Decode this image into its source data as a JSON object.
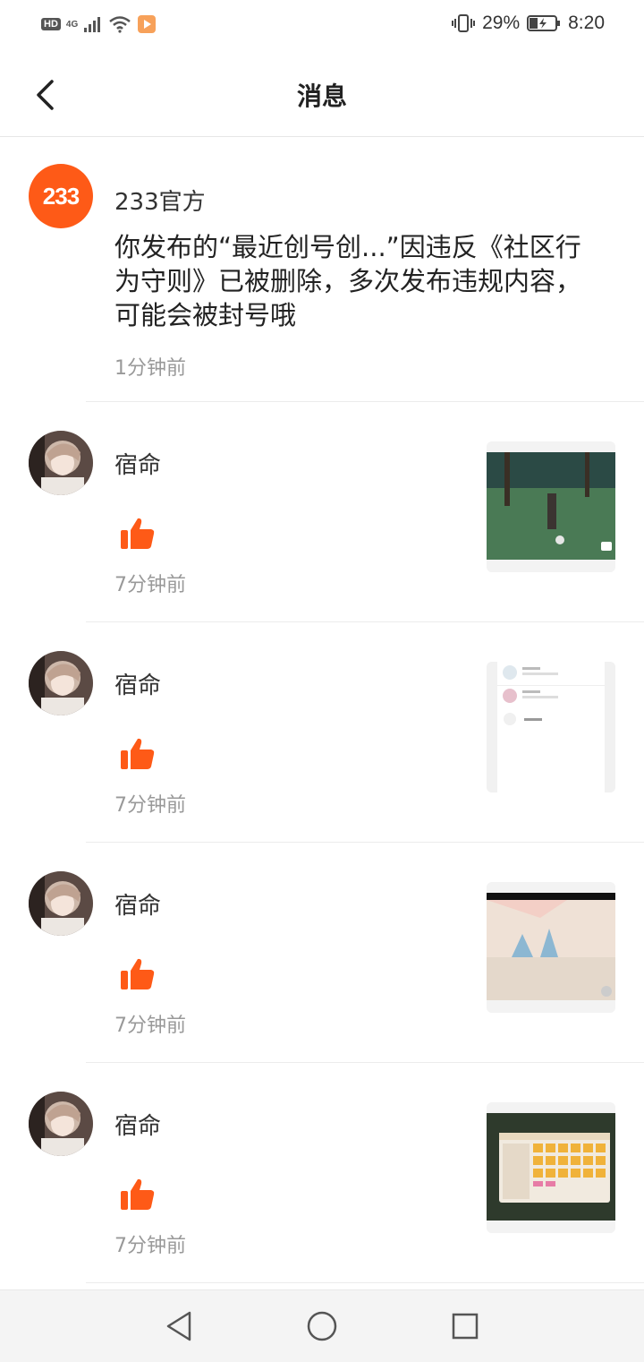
{
  "status_bar": {
    "hd": "HD",
    "network": "4G",
    "battery_percent": "29%",
    "time": "8:20"
  },
  "header": {
    "title": "消息"
  },
  "official_message": {
    "avatar_text": "233",
    "sender": "233官方",
    "content": "你发布的“最近创号创...”因违反《社区行为守则》已被删除，多次发布违规内容，可能会被封号哦",
    "time": "1分钟前"
  },
  "like_messages": [
    {
      "sender": "宿命",
      "time": "7分钟前",
      "preview": "game-scene-forest"
    },
    {
      "sender": "宿命",
      "time": "7分钟前",
      "preview": "account-list-screen"
    },
    {
      "sender": "宿命",
      "time": "7分钟前",
      "preview": "game-scene-room"
    },
    {
      "sender": "宿命",
      "time": "7分钟前",
      "preview": "game-backpack-screen"
    }
  ],
  "colors": {
    "accent": "#fe5a17",
    "secondary_text": "#999999"
  }
}
